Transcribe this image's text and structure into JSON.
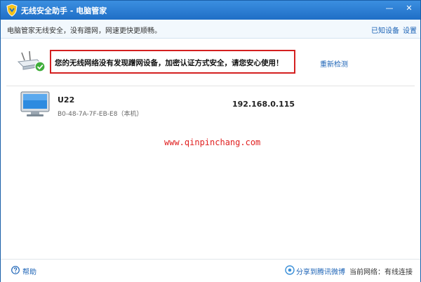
{
  "window": {
    "title": "无线安全助手 - 电脑管家",
    "minimize": "—",
    "close": "✕"
  },
  "topbar": {
    "description": "电脑管家无线安全，没有蹭网，网速更快更顺畅。",
    "known_devices": "已知设备",
    "settings": "设置"
  },
  "alert": {
    "message": "您的无线网络没有发现蹭网设备，加密认证方式安全，请您安心使用！",
    "recheck": "重新检测"
  },
  "devices": [
    {
      "name": "U22",
      "mac": "B0-48-7A-7F-EB-E8（本机）",
      "ip": "192.168.0.115",
      "icon": "monitor-icon"
    }
  ],
  "watermark": "www.qinpinchang.com",
  "footer": {
    "help": "帮助",
    "share": "分享到腾讯微博",
    "network_status": "当前网络：有线连接"
  },
  "colors": {
    "titlebar": "#2a7fd4",
    "link": "#1c63b6",
    "alert_border": "#d42020",
    "watermark": "#e02020"
  }
}
